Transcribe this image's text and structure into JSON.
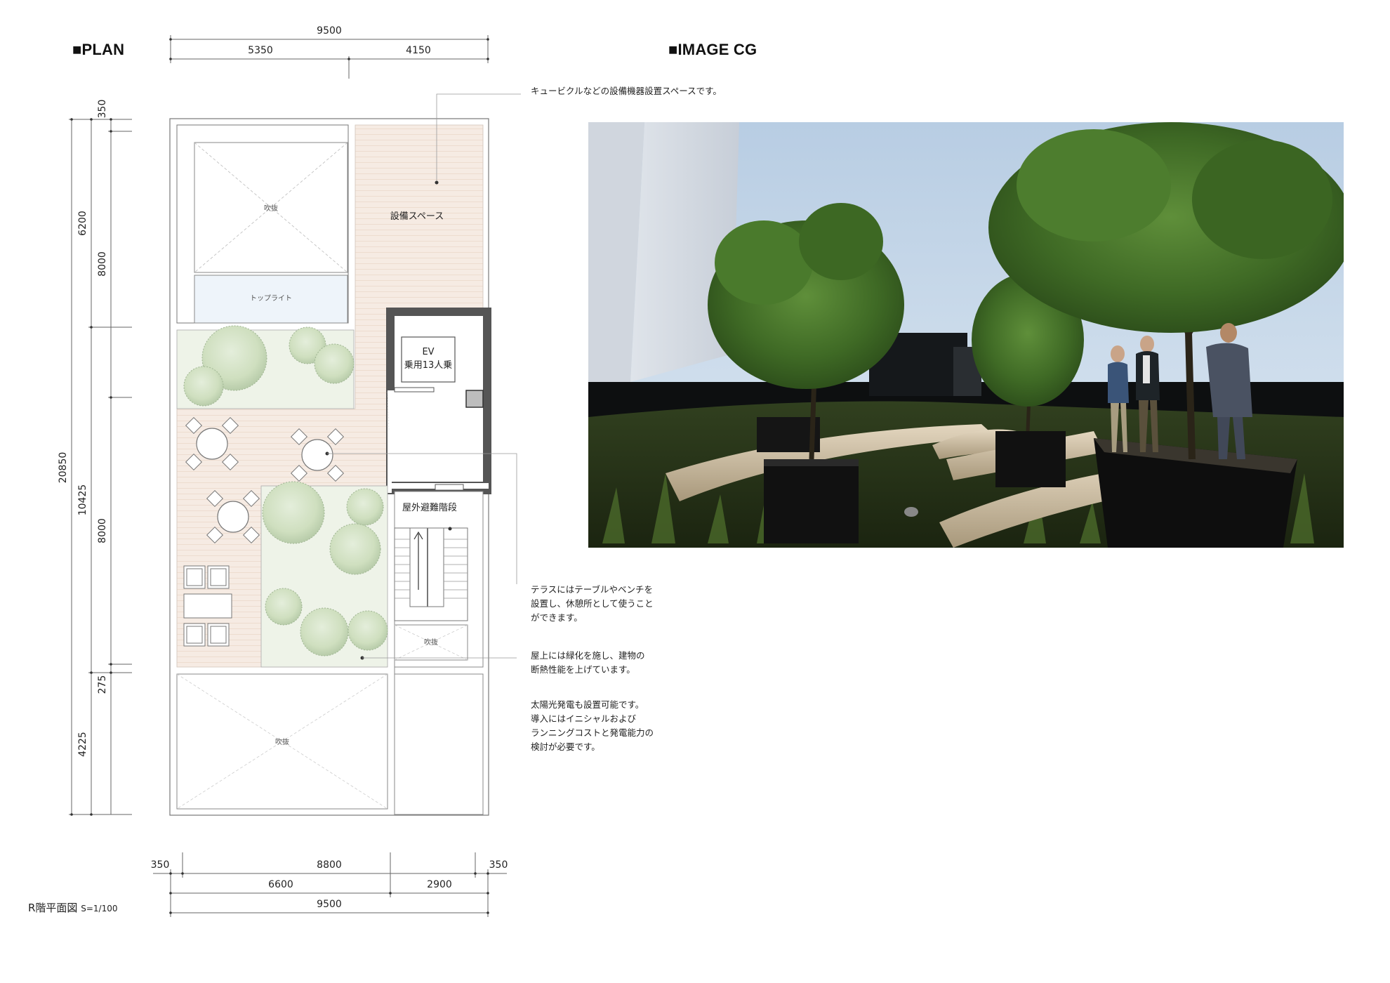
{
  "plan_heading": "■PLAN",
  "cg_heading": "■IMAGE CG",
  "caption": {
    "title": "R階平面図",
    "scale": "S=1/100"
  },
  "dimensions": {
    "top_total": "9500",
    "top_left": "5350",
    "top_right": "4150",
    "left_total": "20850",
    "left_350": "350",
    "left_6200": "6200",
    "left_8000_upper": "8000",
    "left_10425": "10425",
    "left_8000_lower": "8000",
    "left_275": "275",
    "left_4225": "4225",
    "bottom_350_left": "350",
    "bottom_8800": "8800",
    "bottom_350_right": "350",
    "bottom_6600": "6600",
    "bottom_2900": "2900",
    "bottom_total": "9500"
  },
  "rooms": {
    "void_top": "吹抜",
    "toplight": "トップライト",
    "equipment": "設備スペース",
    "ev_line1": "EV",
    "ev_line2": "乗用13人乗",
    "stairs": "屋外避難階段",
    "void_small": "吹抜",
    "void_bottom": "吹抜"
  },
  "notes": {
    "equipment": "キュービクルなどの設備機器設置スペースです。",
    "terrace": "テラスにはテーブルやベンチを\n設置し、休憩所として使うこと\nができます。",
    "greening": "屋上には緑化を施し、建物の\n断熱性能を上げています。",
    "solar": "太陽光発電も設置可能です。\n導入にはイニシャルおよび\nランニングコストと発電能力の\n検討が必要です。"
  },
  "colors": {
    "deck": "#f6ebe3",
    "green": "#eef3e8",
    "toplight": "#eef4fa",
    "tree": "#d3e2c4",
    "wall": "#555555"
  }
}
